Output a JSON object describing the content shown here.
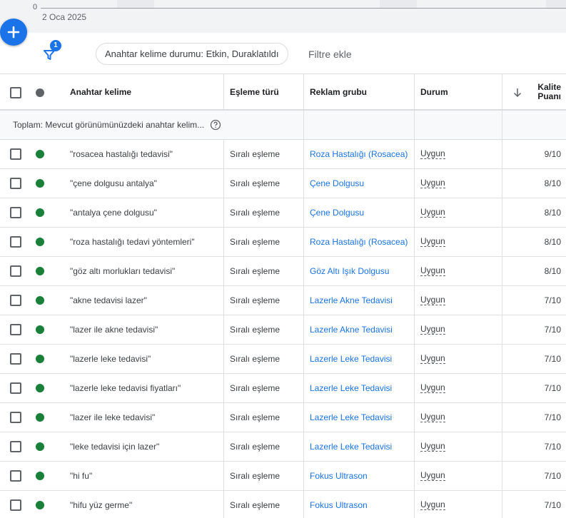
{
  "chart": {
    "y_zero_label": "0",
    "x_start_label": "2 Oca 2025"
  },
  "fab": {
    "icon": "plus-icon"
  },
  "filter_bar": {
    "filter_icon": "filter-icon",
    "filter_count": "1",
    "active_filter": "Anahtar kelime durumu: Etkin, Duraklatıldı",
    "add_filter": "Filtre ekle"
  },
  "table": {
    "headers": {
      "keyword": "Anahtar kelime",
      "match_type": "Eşleme türü",
      "ad_group": "Reklam grubu",
      "status": "Durum",
      "sort_icon": "arrow-down-icon",
      "quality_line1": "Kalite",
      "quality_line2": "Puanı"
    },
    "total_label": "Toplam: Mevcut görünümünüzdeki anahtar kelim...",
    "rows": [
      {
        "keyword": "\"rosacea hastalığı tedavisi\"",
        "match": "Sıralı eşleme",
        "group": "Roza Hastalığı (Rosacea)",
        "status": "Uygun",
        "quality": "9/10"
      },
      {
        "keyword": "\"çene dolgusu antalya\"",
        "match": "Sıralı eşleme",
        "group": "Çene Dolgusu",
        "status": "Uygun",
        "quality": "8/10"
      },
      {
        "keyword": "\"antalya çene dolgusu\"",
        "match": "Sıralı eşleme",
        "group": "Çene Dolgusu",
        "status": "Uygun",
        "quality": "8/10"
      },
      {
        "keyword": "\"roza hastalığı tedavi yöntemleri\"",
        "match": "Sıralı eşleme",
        "group": "Roza Hastalığı (Rosacea)",
        "status": "Uygun",
        "quality": "8/10"
      },
      {
        "keyword": "\"göz altı morlukları tedavisi\"",
        "match": "Sıralı eşleme",
        "group": "Göz Altı Işık Dolgusu",
        "status": "Uygun",
        "quality": "8/10"
      },
      {
        "keyword": "\"akne tedavisi lazer\"",
        "match": "Sıralı eşleme",
        "group": "Lazerle Akne Tedavisi",
        "status": "Uygun",
        "quality": "7/10"
      },
      {
        "keyword": "\"lazer ile akne tedavisi\"",
        "match": "Sıralı eşleme",
        "group": "Lazerle Akne Tedavisi",
        "status": "Uygun",
        "quality": "7/10"
      },
      {
        "keyword": "\"lazerle leke tedavisi\"",
        "match": "Sıralı eşleme",
        "group": "Lazerle Leke Tedavisi",
        "status": "Uygun",
        "quality": "7/10"
      },
      {
        "keyword": "\"lazerle leke tedavisi fiyatları\"",
        "match": "Sıralı eşleme",
        "group": "Lazerle Leke Tedavisi",
        "status": "Uygun",
        "quality": "7/10"
      },
      {
        "keyword": "\"lazer ile leke tedavisi\"",
        "match": "Sıralı eşleme",
        "group": "Lazerle Leke Tedavisi",
        "status": "Uygun",
        "quality": "7/10"
      },
      {
        "keyword": "\"leke tedavisi için lazer\"",
        "match": "Sıralı eşleme",
        "group": "Lazerle Leke Tedavisi",
        "status": "Uygun",
        "quality": "7/10"
      },
      {
        "keyword": "\"hi fu\"",
        "match": "Sıralı eşleme",
        "group": "Fokus Ultrason",
        "status": "Uygun",
        "quality": "7/10"
      },
      {
        "keyword": "\"hifu yüz germe\"",
        "match": "Sıralı eşleme",
        "group": "Fokus Ultrason",
        "status": "Uygun",
        "quality": "7/10"
      }
    ]
  },
  "colors": {
    "accent": "#1a73e8",
    "enabled_status": "#188038"
  }
}
